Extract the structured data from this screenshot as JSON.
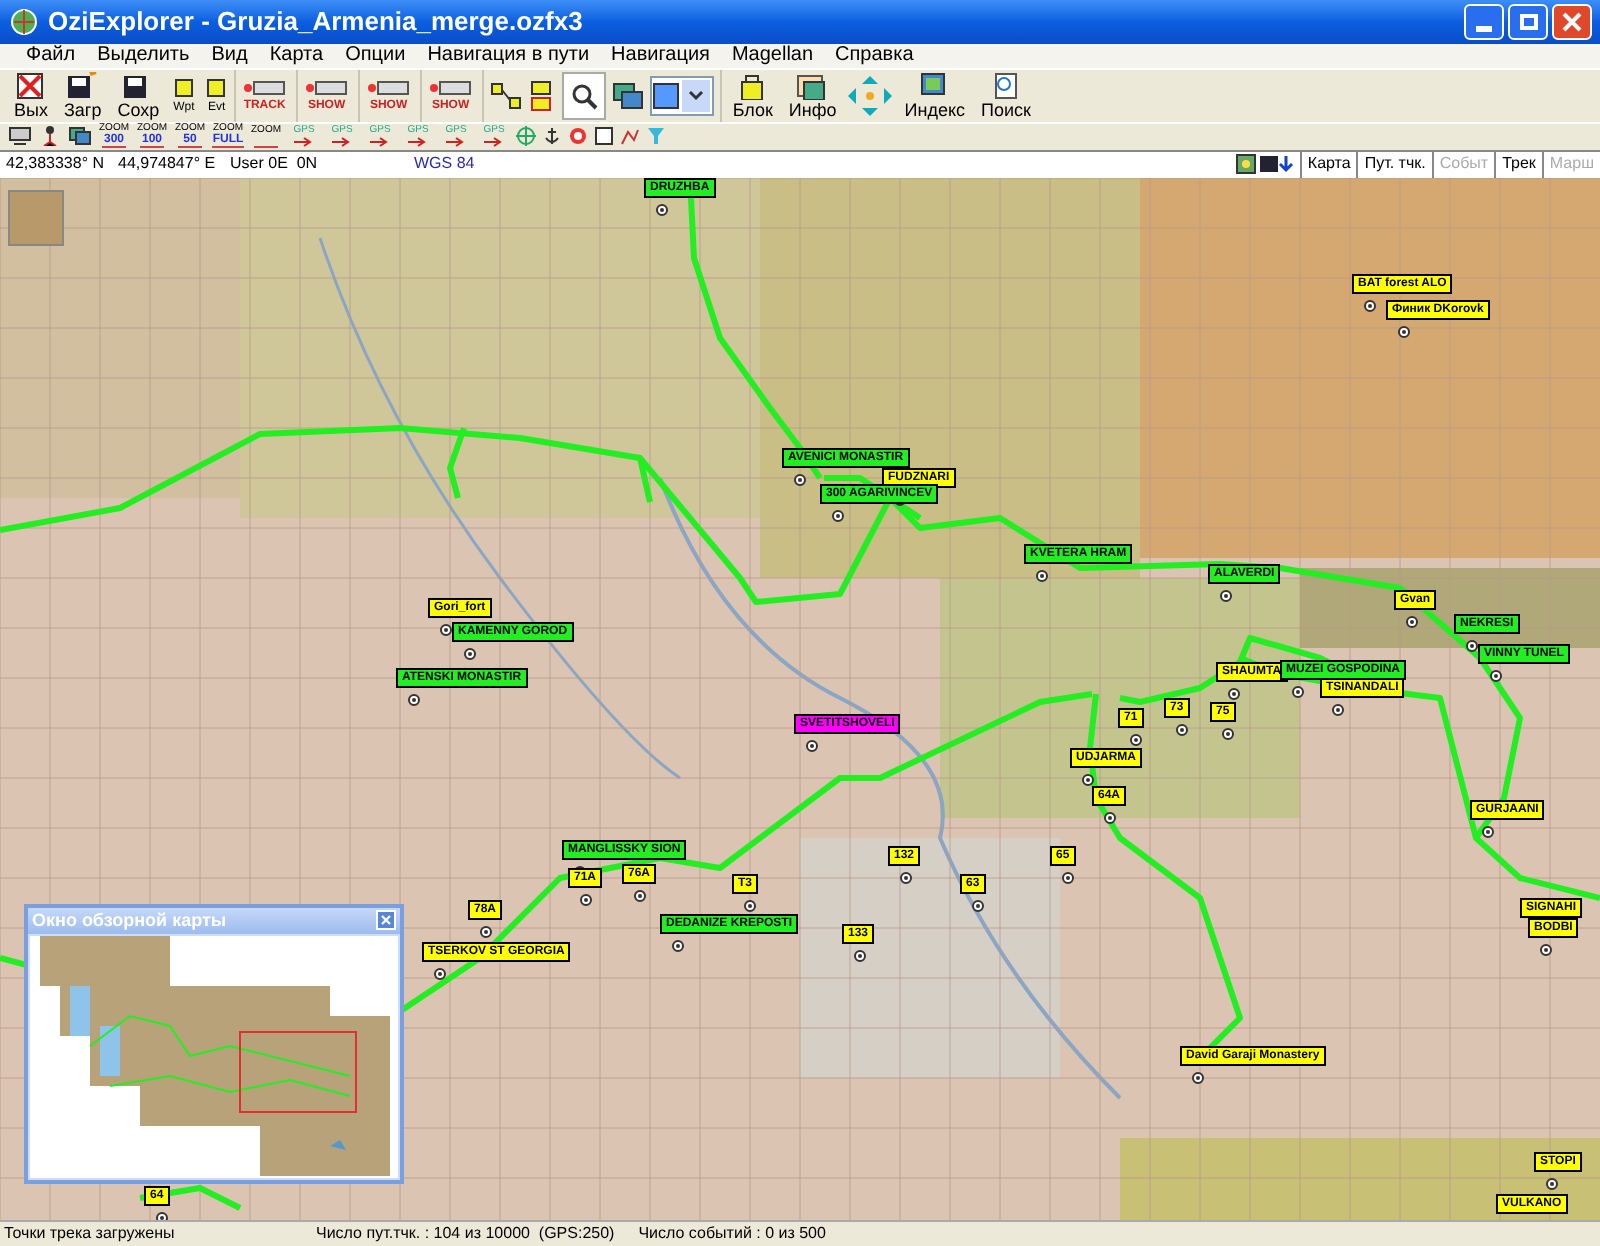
{
  "window": {
    "title": "OziExplorer - Gruzia_Armenia_merge.ozfx3"
  },
  "menu": [
    "Файл",
    "Выделить",
    "Вид",
    "Карта",
    "Опции",
    "Навигация в пути",
    "Навигация",
    "Magellan",
    "Справка"
  ],
  "toolbar": [
    {
      "kind": "big",
      "label": "Вых"
    },
    {
      "kind": "big",
      "label": "Загр"
    },
    {
      "kind": "big",
      "label": "Сохр"
    },
    {
      "kind": "small",
      "label": "Wpt"
    },
    {
      "kind": "small",
      "label": "Evt"
    },
    {
      "kind": "tag",
      "label": "TRACK"
    },
    {
      "kind": "tag",
      "label": "SHOW"
    },
    {
      "kind": "tag",
      "label": "SHOW"
    },
    {
      "kind": "tag",
      "label": "SHOW"
    },
    {
      "kind": "tools"
    },
    {
      "kind": "big",
      "label": "Блок"
    },
    {
      "kind": "big",
      "label": "Инфо"
    },
    {
      "kind": "arrows"
    },
    {
      "kind": "big",
      "label": "Индекс"
    },
    {
      "kind": "big",
      "label": "Поиск"
    }
  ],
  "toolbar_secondary": [
    {
      "kind": "zoom",
      "label": "ZOOM",
      "value": "300"
    },
    {
      "kind": "zoom",
      "label": "ZOOM",
      "value": "100"
    },
    {
      "kind": "zoom",
      "label": "ZOOM",
      "value": "50"
    },
    {
      "kind": "zoom",
      "label": "ZOOM",
      "value": "FULL"
    },
    {
      "kind": "zoom",
      "label": "ZOOM"
    },
    {
      "kind": "gps",
      "label": "GPS"
    },
    {
      "kind": "gps",
      "label": "GPS"
    },
    {
      "kind": "gps",
      "label": "GPS"
    },
    {
      "kind": "gps",
      "label": "GPS"
    },
    {
      "kind": "gps",
      "label": "GPS"
    },
    {
      "kind": "gps",
      "label": "GPS"
    }
  ],
  "coordinates": {
    "latitude": "42,383338° N",
    "longitude": "44,974847° E",
    "user_grid": "User 0E  0N",
    "datum": "WGS 84"
  },
  "view_buttons": [
    {
      "label": "Карта",
      "disabled": false
    },
    {
      "label": "Пут. тчк.",
      "disabled": false
    },
    {
      "label": "Событ",
      "disabled": true
    },
    {
      "label": "Трек",
      "disabled": false
    },
    {
      "label": "Марш",
      "disabled": true
    }
  ],
  "waypoints": [
    {
      "label": "DRUZHBA",
      "color": "#22ee22"
    },
    {
      "label": "BAT forest ALO",
      "color": "#ffff00"
    },
    {
      "label": "Финик DKorovk",
      "color": "#ffff00"
    },
    {
      "label": "AVENICI MONASTIR",
      "color": "#22ee22"
    },
    {
      "label": "FUDZNARI",
      "color": "#ffff00"
    },
    {
      "label": "300 AGARIVINCEV",
      "color": "#22ee22"
    },
    {
      "label": "KVETERA HRAM",
      "color": "#22ee22"
    },
    {
      "label": "ALAVERDI",
      "color": "#22ee22"
    },
    {
      "label": "Gvan",
      "color": "#ffff00"
    },
    {
      "label": "NEKRESI",
      "color": "#22ee22"
    },
    {
      "label": "VINNY TUNEL",
      "color": "#22ee22"
    },
    {
      "label": "SHAUMTA",
      "color": "#ffff00"
    },
    {
      "label": "MUZEI GOSPODINA",
      "color": "#22ee22"
    },
    {
      "label": "TSINANDALI",
      "color": "#ffff00"
    },
    {
      "label": "71",
      "color": "#ffff00"
    },
    {
      "label": "73",
      "color": "#ffff00"
    },
    {
      "label": "75",
      "color": "#ffff00"
    },
    {
      "label": "UDJARMA",
      "color": "#ffff00"
    },
    {
      "label": "64A",
      "color": "#ffff00"
    },
    {
      "label": "GURJAANI",
      "color": "#ffff00"
    },
    {
      "label": "SIGNAHI",
      "color": "#ffff00"
    },
    {
      "label": "BODBI",
      "color": "#ffff00"
    },
    {
      "label": "Gori_fort",
      "color": "#ffff00"
    },
    {
      "label": "KAMENNY GOROD",
      "color": "#22ee22"
    },
    {
      "label": "ATENSKI MONASTIR",
      "color": "#22ee22"
    },
    {
      "label": "SVETITSHOVELI",
      "color": "#ff00ff"
    },
    {
      "label": "MANGLISSKY SION",
      "color": "#22ee22"
    },
    {
      "label": "71A",
      "color": "#ffff00"
    },
    {
      "label": "76A",
      "color": "#ffff00"
    },
    {
      "label": "78A",
      "color": "#ffff00"
    },
    {
      "label": "T3",
      "color": "#ffff00"
    },
    {
      "label": "DEDANIZE KREPOSTI",
      "color": "#22ee22"
    },
    {
      "label": "TSERKOV ST GEORGIA",
      "color": "#ffff00"
    },
    {
      "label": "132",
      "color": "#ffff00"
    },
    {
      "label": "133",
      "color": "#ffff00"
    },
    {
      "label": "63",
      "color": "#ffff00"
    },
    {
      "label": "65",
      "color": "#ffff00"
    },
    {
      "label": "David Garaji Monastery",
      "color": "#ffff00"
    },
    {
      "label": "STOPI",
      "color": "#ffff00"
    },
    {
      "label": "VULKANO",
      "color": "#ffff00"
    },
    {
      "label": "64",
      "color": "#ffff00"
    }
  ],
  "overview_window": {
    "title": "Окно обзорной карты"
  },
  "status_bar": [
    "Точки трека загружены",
    "Число пут.тчк. : 104 из 10000  (GPS:250)",
    "Число событий : 0 из 500"
  ]
}
